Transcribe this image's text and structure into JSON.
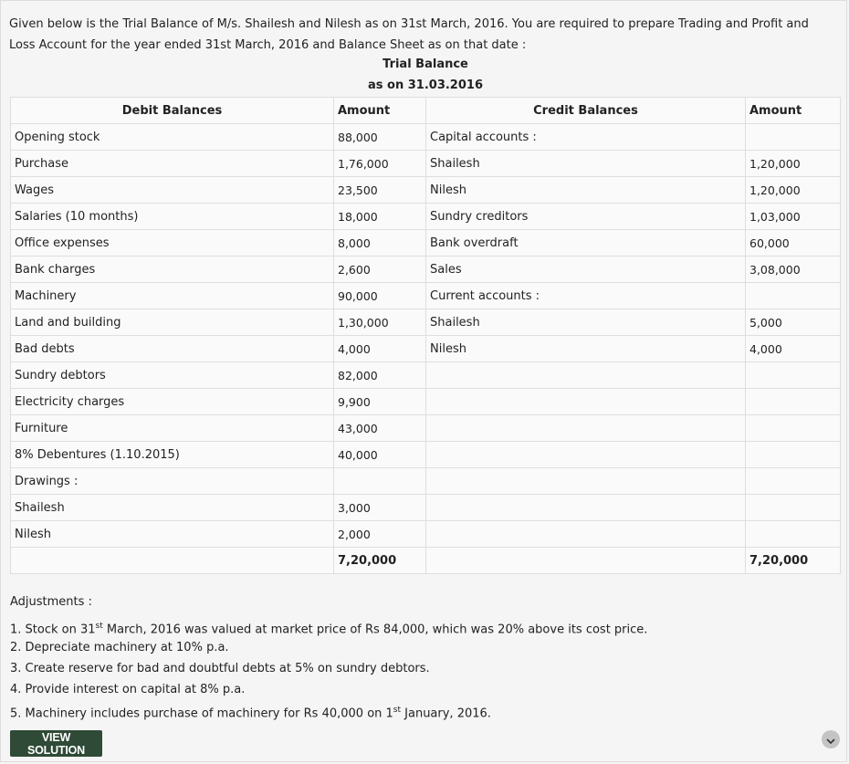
{
  "intro": "Given below is the Trial Balance of M/s. Shailesh and Nilesh as on 31st March, 2016. You are required to prepare Trading and Profit and Loss Account for the year ended 31st March, 2016 and Balance Sheet as on that date :",
  "table_title": "Trial Balance",
  "table_subtitle": "as on 31.03.2016",
  "headers": {
    "debit": "Debit Balances",
    "debit_amount": "Amount",
    "credit": "Credit Balances",
    "credit_amount": "Amount"
  },
  "rows": [
    {
      "debit": "Opening stock",
      "debit_amount": "88,000",
      "credit": "Capital accounts :",
      "credit_amount": ""
    },
    {
      "debit": "Purchase",
      "debit_amount": "1,76,000",
      "credit": "Shailesh",
      "credit_amount": "1,20,000"
    },
    {
      "debit": "Wages",
      "debit_amount": "23,500",
      "credit": "Nilesh",
      "credit_amount": "1,20,000"
    },
    {
      "debit": "Salaries (10 months)",
      "debit_amount": "18,000",
      "credit": "Sundry creditors",
      "credit_amount": "1,03,000"
    },
    {
      "debit": "Office expenses",
      "debit_amount": "8,000",
      "credit": "Bank overdraft",
      "credit_amount": "60,000"
    },
    {
      "debit": "Bank charges",
      "debit_amount": "2,600",
      "credit": "Sales",
      "credit_amount": "3,08,000"
    },
    {
      "debit": "Machinery",
      "debit_amount": "90,000",
      "credit": "Current accounts :",
      "credit_amount": ""
    },
    {
      "debit": "Land and building",
      "debit_amount": "1,30,000",
      "credit": "Shailesh",
      "credit_amount": "5,000"
    },
    {
      "debit": "Bad debts",
      "debit_amount": "4,000",
      "credit": "Nilesh",
      "credit_amount": "4,000"
    },
    {
      "debit": "Sundry debtors",
      "debit_amount": "82,000",
      "credit": "",
      "credit_amount": ""
    },
    {
      "debit": "Electricity charges",
      "debit_amount": "9,900",
      "credit": "",
      "credit_amount": ""
    },
    {
      "debit": "Furniture",
      "debit_amount": "43,000",
      "credit": "",
      "credit_amount": ""
    },
    {
      "debit": "8% Debentures (1.10.2015)",
      "debit_amount": "40,000",
      "credit": "",
      "credit_amount": ""
    },
    {
      "debit": "Drawings :",
      "debit_amount": "",
      "credit": "",
      "credit_amount": ""
    },
    {
      "debit": "Shailesh",
      "debit_amount": "3,000",
      "credit": "",
      "credit_amount": ""
    },
    {
      "debit": "Nilesh",
      "debit_amount": "2,000",
      "credit": "",
      "credit_amount": ""
    }
  ],
  "totals": {
    "debit_amount": "7,20,000",
    "credit_amount": "7,20,000"
  },
  "adjustments": {
    "heading": "Adjustments :",
    "items": [
      {
        "pre": "1. Stock on 31",
        "sup": "st",
        "post": " March, 2016 was valued at market price of Rs 84,000, which was 20% above its cost price."
      },
      {
        "pre": "2. Depreciate machinery at 10% p.a.",
        "sup": "",
        "post": ""
      },
      {
        "pre": "3. Create reserve for bad and doubtful debts at 5% on sundry debtors.",
        "sup": "",
        "post": ""
      },
      {
        "pre": "4. Provide interest on capital at 8% p.a.",
        "sup": "",
        "post": ""
      },
      {
        "pre": "5. Machinery includes purchase of machinery for Rs 40,000 on 1",
        "sup": "st",
        "post": " January, 2016."
      }
    ]
  },
  "button_label": "VIEW SOLUTION",
  "icons": {
    "expand": "chevron-down-icon"
  },
  "colors": {
    "button_bg": "#2f4a36",
    "chevron_bg": "#c4c4c4"
  }
}
